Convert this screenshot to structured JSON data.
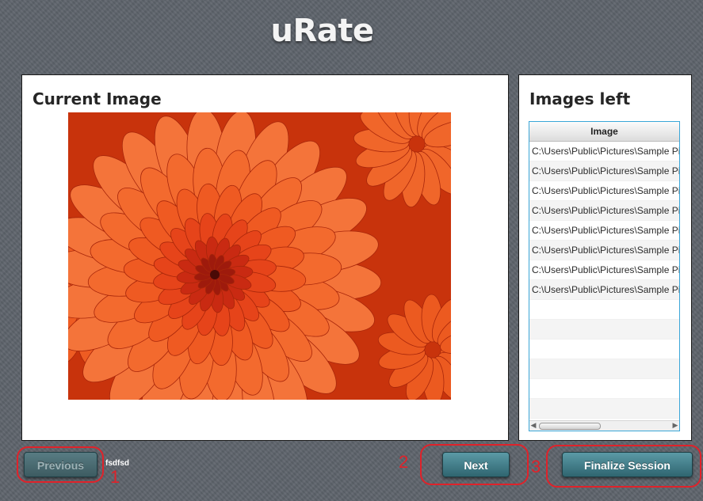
{
  "app": {
    "title": "uRate"
  },
  "current_panel": {
    "heading": "Current Image",
    "image_description": "orange-chrysanthemum-flower"
  },
  "images_left_panel": {
    "heading": "Images left",
    "table": {
      "column_header": "Image",
      "rows": [
        "C:\\Users\\Public\\Pictures\\Sample Pi...",
        "C:\\Users\\Public\\Pictures\\Sample Pi...",
        "C:\\Users\\Public\\Pictures\\Sample Pi...",
        "C:\\Users\\Public\\Pictures\\Sample Pi...",
        "C:\\Users\\Public\\Pictures\\Sample Pi...",
        "C:\\Users\\Public\\Pictures\\Sample Pi...",
        "C:\\Users\\Public\\Pictures\\Sample Pi...",
        "C:\\Users\\Public\\Pictures\\Sample Pi..."
      ]
    }
  },
  "controls": {
    "previous_label": "Previous",
    "status_text": "fsdfsd",
    "next_label": "Next",
    "finalize_label": "Finalize Session"
  },
  "annotations": {
    "marker_1": "1",
    "marker_2": "2",
    "marker_3": "3"
  },
  "colors": {
    "button": "#3f7f8a",
    "annotation": "#e0222a",
    "table_border": "#3aa6d8",
    "background": "#5d636b"
  }
}
